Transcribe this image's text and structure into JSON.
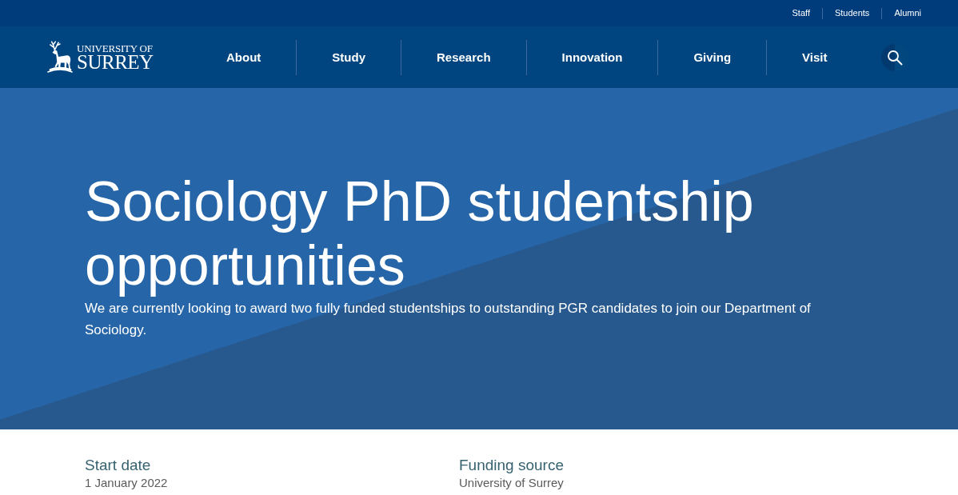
{
  "utility_nav": {
    "links": [
      "Staff",
      "Students",
      "Alumni"
    ]
  },
  "header": {
    "logo": {
      "line_1": "UNIVERSITY OF",
      "line_2": "SURREY"
    },
    "nav_items": [
      "About",
      "Study",
      "Research",
      "Innovation",
      "Giving",
      "Visit"
    ]
  },
  "hero": {
    "title": "Sociology PhD studentship opportunities",
    "summary": "We are currently looking to award two fully funded studentships to outstanding PGR candidates to join our Department of Sociology."
  },
  "details": [
    {
      "label": "Start date",
      "value": "1 January 2022"
    },
    {
      "label": "Funding source",
      "value": "University of Surrey"
    }
  ]
}
